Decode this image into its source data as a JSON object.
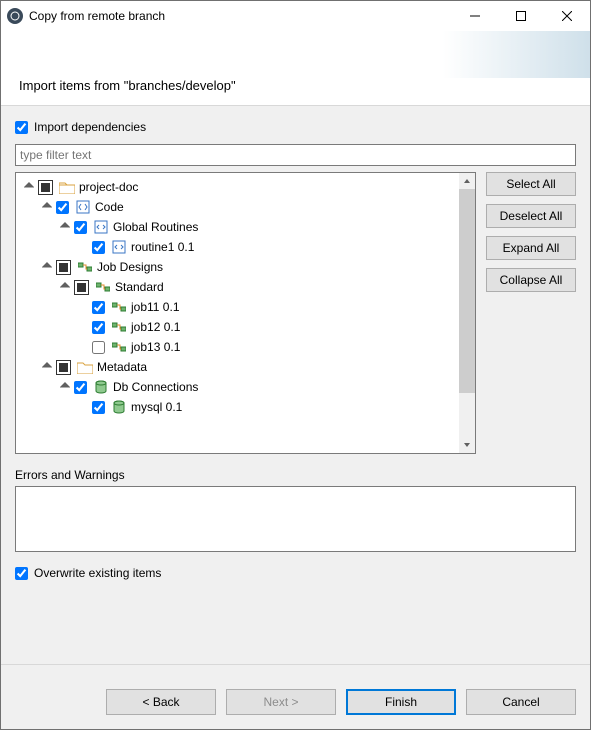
{
  "window": {
    "title": "Copy from remote branch"
  },
  "header": {
    "subtitle": "Import items from \"branches/develop\""
  },
  "options": {
    "import_deps_label": "Import dependencies",
    "overwrite_label": "Overwrite existing items"
  },
  "filter": {
    "placeholder": "type filter text",
    "value": ""
  },
  "side_buttons": {
    "select_all": "Select All",
    "deselect_all": "Deselect All",
    "expand_all": "Expand All",
    "collapse_all": "Collapse All"
  },
  "errors": {
    "label": "Errors and Warnings",
    "text": ""
  },
  "footer": {
    "back": "< Back",
    "next": "Next >",
    "finish": "Finish",
    "cancel": "Cancel"
  },
  "tree": {
    "items": [
      {
        "depth": 1,
        "expanded": true,
        "check": "partial",
        "icon": "folder",
        "label": "project-doc"
      },
      {
        "depth": 2,
        "expanded": true,
        "check": "checked",
        "icon": "code-grp",
        "label": "Code"
      },
      {
        "depth": 3,
        "expanded": true,
        "check": "checked",
        "icon": "code",
        "label": "Global Routines"
      },
      {
        "depth": 4,
        "expanded": null,
        "check": "checked",
        "icon": "code",
        "label": "routine1 0.1"
      },
      {
        "depth": 2,
        "expanded": true,
        "check": "partial",
        "icon": "job-grp",
        "label": "Job Designs"
      },
      {
        "depth": 3,
        "expanded": true,
        "check": "partial",
        "icon": "job-grp",
        "label": "Standard"
      },
      {
        "depth": 4,
        "expanded": null,
        "check": "checked",
        "icon": "job",
        "label": "job11 0.1"
      },
      {
        "depth": 4,
        "expanded": null,
        "check": "checked",
        "icon": "job",
        "label": "job12 0.1"
      },
      {
        "depth": 4,
        "expanded": null,
        "check": "unchecked",
        "icon": "job",
        "label": "job13 0.1"
      },
      {
        "depth": 2,
        "expanded": true,
        "check": "partial",
        "icon": "meta",
        "label": "Metadata"
      },
      {
        "depth": 3,
        "expanded": true,
        "check": "checked",
        "icon": "db-grp",
        "label": "Db Connections"
      },
      {
        "depth": 4,
        "expanded": null,
        "check": "checked",
        "icon": "db",
        "label": "mysql 0.1"
      }
    ]
  }
}
